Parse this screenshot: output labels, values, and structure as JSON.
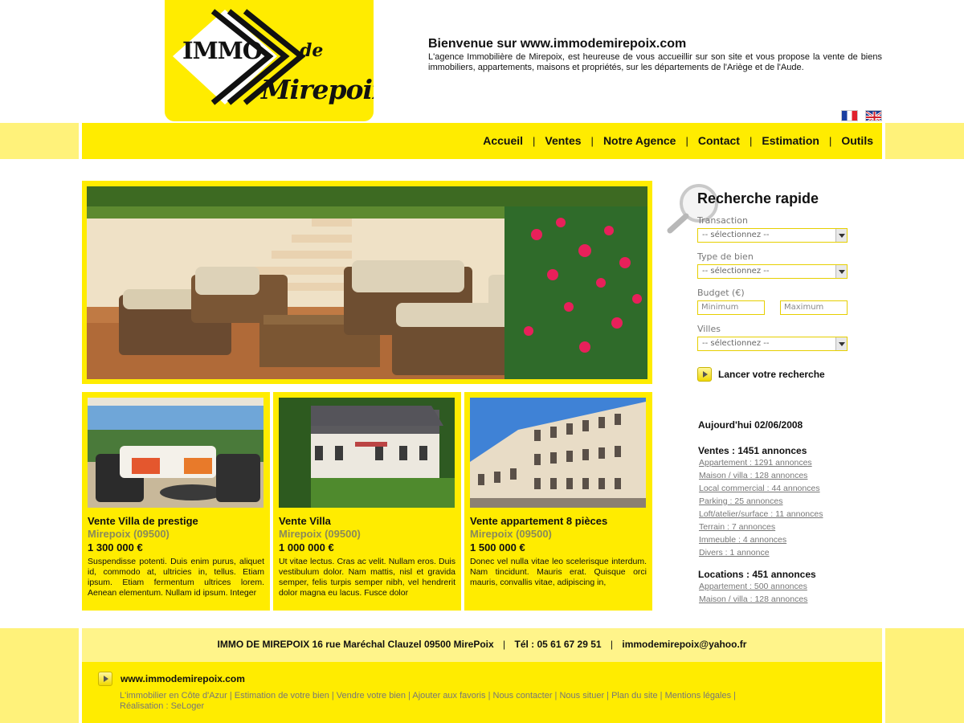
{
  "logo": {
    "line1": "IMMO",
    "line2": "de",
    "line3": "Mirepoix"
  },
  "welcome": {
    "title": "Bienvenue sur www.immodemirepoix.com",
    "text": "L'agence Immobilière de Mirepoix, est heureuse de vous accueillir sur son site et vous propose la vente de biens immobiliers, appartements, maisons et propriétés, sur les départements de l'Ariège et de l'Aude."
  },
  "nav": [
    "Accueil",
    "Ventes",
    "Notre Agence",
    "Contact",
    "Estimation",
    "Outils"
  ],
  "listings": [
    {
      "title": "Vente Villa de prestige",
      "location": "Mirepoix (09500)",
      "price": "1 300 000 €",
      "description": "Suspendisse potenti. Duis enim purus, aliquet id, commodo at, ultricies in, tellus. Etiam ipsum. Etiam fermentum ultrices lorem. Aenean elementum. Nullam id ipsum. Integer"
    },
    {
      "title": "Vente Villa",
      "location": "Mirepoix (09500)",
      "price": "1 000 000 €",
      "description": "Ut vitae lectus. Cras ac velit. Nullam eros. Duis vestibulum dolor. Nam mattis, nisl et gravida semper, felis turpis semper nibh, vel hendrerit dolor magna eu lacus. Fusce dolor"
    },
    {
      "title": "Vente appartement 8 pièces",
      "location": "Mirepoix (09500)",
      "price": "1 500 000 €",
      "description": "Donec vel nulla vitae leo scelerisque interdum. Nam tincidunt. Mauris erat. Quisque orci mauris, convallis vitae, adipiscing in,"
    }
  ],
  "search": {
    "title": "Recherche rapide",
    "transaction_label": "Transaction",
    "transaction_value": "-- sélectionnez --",
    "type_label": "Type de bien",
    "type_value": "-- sélectionnez --",
    "budget_label": "Budget (€)",
    "min_placeholder": "Minimum",
    "max_placeholder": "Maximum",
    "villes_label": "Villes",
    "villes_value": "-- sélectionnez --",
    "button": "Lancer votre recherche"
  },
  "stats": {
    "date": "Aujourd'hui 02/06/2008",
    "ventes_head": "Ventes : 1451 annonces",
    "ventes": [
      "Appartement : 1291 annonces",
      "Maison / villa : 128 annonces",
      "Local commercial : 44 annonces",
      "Parking : 25 annonces",
      "Loft/atelier/surface : 11 annonces",
      "Terrain : 7 annonces",
      "Immeuble : 4 annonces",
      "Divers : 1 annonce"
    ],
    "locations_head": "Locations : 451 annonces",
    "locations": [
      "Appartement : 500 annonces",
      "Maison / villa : 128 annonces"
    ]
  },
  "footer": {
    "address": "IMMO DE MIREPOIX 16 rue Maréchal Clauzel 09500 MirePoix",
    "phone": "Tél : 05 61 67 29 51",
    "email": "immodemirepoix@yahoo.fr",
    "site": "www.immodemirepoix.com",
    "links": [
      "L'immobilier en Côte d'Azur",
      "Estimation de votre bien",
      "Vendre votre bien",
      "Ajouter aux favoris",
      "Nous contacter",
      "Nous situer",
      "Plan du site",
      "Mentions légales"
    ],
    "credit": "Réalisation : SeLoger"
  },
  "colors": {
    "brand_yellow": "#ffec00",
    "light_yellow": "#fff27a",
    "muted_text": "#777777"
  }
}
